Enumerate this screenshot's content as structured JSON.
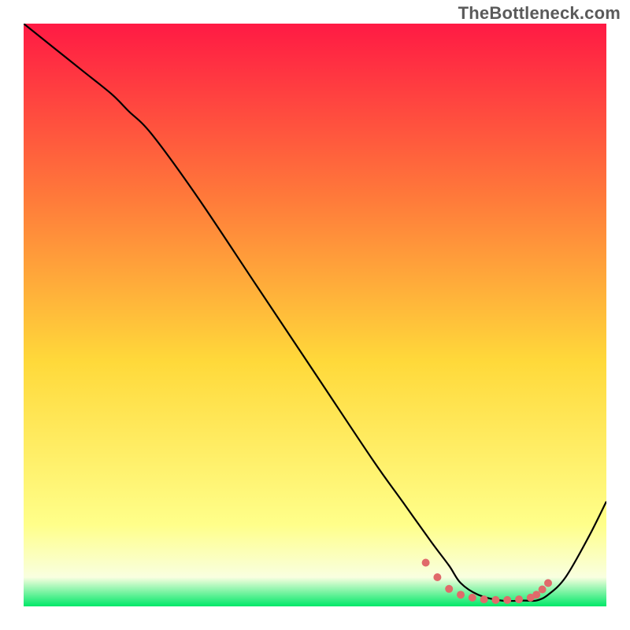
{
  "watermark": "TheBottleneck.com",
  "chart_data": {
    "type": "line",
    "title": "",
    "xlabel": "",
    "ylabel": "",
    "xlim": [
      0,
      100
    ],
    "ylim": [
      0,
      100
    ],
    "grid": false,
    "legend": false,
    "background_gradient": {
      "top_color": "#ff1a44",
      "mid_top_color": "#ff7a3a",
      "mid_color": "#ffd93a",
      "mid_bottom_color": "#ffff8a",
      "band_color": "#f9ffe0",
      "bottom_color": "#00e868"
    },
    "series": [
      {
        "name": "bottleneck-curve",
        "color": "#000000",
        "x": [
          0,
          5,
          10,
          15,
          18,
          22,
          30,
          40,
          50,
          60,
          65,
          70,
          73,
          75,
          78,
          82,
          86,
          88,
          90,
          93,
          97,
          100
        ],
        "y": [
          100,
          96,
          92,
          88,
          85,
          81,
          70,
          55,
          40,
          25,
          18,
          11,
          7,
          4,
          2,
          1,
          1,
          1,
          2,
          5,
          12,
          18
        ]
      }
    ],
    "annotations": [
      {
        "name": "trough-dots",
        "color": "#e06a6a",
        "size": 5,
        "points": [
          {
            "x": 69,
            "y": 7.5
          },
          {
            "x": 71,
            "y": 5.0
          },
          {
            "x": 73,
            "y": 3.0
          },
          {
            "x": 75,
            "y": 2.0
          },
          {
            "x": 77,
            "y": 1.5
          },
          {
            "x": 79,
            "y": 1.2
          },
          {
            "x": 81,
            "y": 1.1
          },
          {
            "x": 83,
            "y": 1.1
          },
          {
            "x": 85,
            "y": 1.2
          },
          {
            "x": 87,
            "y": 1.5
          },
          {
            "x": 88,
            "y": 2.0
          },
          {
            "x": 89,
            "y": 2.9
          },
          {
            "x": 90,
            "y": 4.0
          }
        ]
      }
    ]
  }
}
